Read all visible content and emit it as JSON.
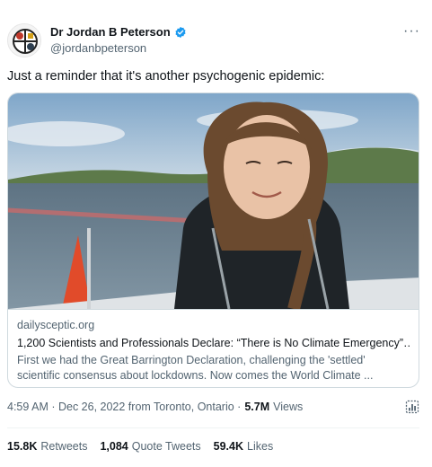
{
  "author": {
    "display_name": "Dr Jordan B Peterson",
    "handle": "@jordanbpeterson",
    "verified_icon": "verified-badge-icon",
    "verified_color": "#1d9bf0"
  },
  "tweet": {
    "text": "Just a reminder that it's another psychogenic epidemic:"
  },
  "card": {
    "domain": "dailysceptic.org",
    "title": "1,200 Scientists and Professionals Declare: “There is No Climate Emergency”…",
    "description_line1": "First we had the Great Barrington Declaration, challenging the 'settled'",
    "description_line2": "scientific consensus about lockdowns. Now comes the World Climate ..."
  },
  "meta": {
    "timestamp": "4:59 AM · Dec 26, 2022 from Toronto, Ontario ·",
    "views_count": "5.7M",
    "views_label": "Views",
    "analytics_icon": "analytics-icon"
  },
  "stats": {
    "retweets_count": "15.8K",
    "retweets_label": "Retweets",
    "quotes_count": "1,084",
    "quotes_label": "Quote Tweets",
    "likes_count": "59.4K",
    "likes_label": "Likes"
  },
  "colors": {
    "text_primary": "#0f1419",
    "text_secondary": "#536471",
    "border": "#cfd9de"
  }
}
